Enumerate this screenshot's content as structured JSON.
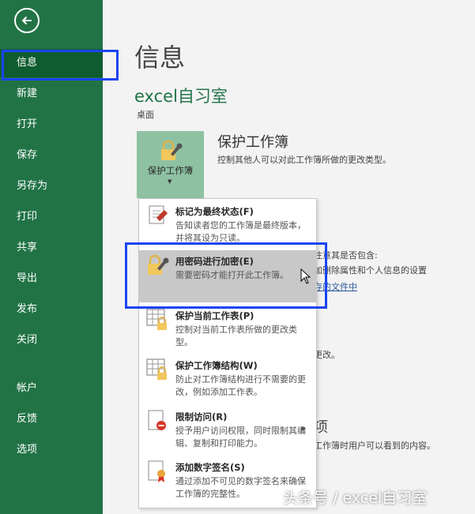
{
  "sidebar": {
    "items": [
      {
        "label": "信息"
      },
      {
        "label": "新建"
      },
      {
        "label": "打开"
      },
      {
        "label": "保存"
      },
      {
        "label": "另存为"
      },
      {
        "label": "打印"
      },
      {
        "label": "共享"
      },
      {
        "label": "导出"
      },
      {
        "label": "发布"
      },
      {
        "label": "关闭"
      },
      {
        "label": "帐户"
      },
      {
        "label": "反馈"
      },
      {
        "label": "选项"
      }
    ],
    "active": "信息"
  },
  "main": {
    "title": "信息",
    "workbook_name": "excel自习室",
    "location": "桌面",
    "protect": {
      "button_label": "保护工作簿",
      "heading": "保护工作簿",
      "description": "控制其他人可以对此工作簿所做的更改类型。"
    },
    "background_fragments": {
      "inspect_line": "注意其是否包含:",
      "inspect_detail": "加删除属性和个人信息的设置",
      "link": "存的文件中",
      "versions_tail": "更改。",
      "browser_letter": "项",
      "browser_desc": "工作簿时用户可以看到的内容。"
    }
  },
  "menu": {
    "items": [
      {
        "title": "标记为最终状态(F)",
        "desc": "告知读者您的工作簿是最终版本，并将其设为只读。"
      },
      {
        "title": "用密码进行加密(E)",
        "desc": "需要密码才能打开此工作簿。"
      },
      {
        "title": "保护当前工作表(P)",
        "desc": "控制对当前工作表所做的更改类型。"
      },
      {
        "title": "保护工作簿结构(W)",
        "desc": "防止对工作簿结构进行不需要的更改，例如添加工作表。"
      },
      {
        "title": "限制访问(R)",
        "desc": "授予用户访问权限，同时限制其编辑、复制和打印能力。"
      },
      {
        "title": "添加数字签名(S)",
        "desc": "通过添加不可见的数字签名来确保工作簿的完整性。"
      }
    ],
    "hovered": "用密码进行加密(E)"
  },
  "watermark": "头条号 / excel自习室",
  "colors": {
    "sidebar": "#217346",
    "accent": "#217346",
    "highlight": "#1a44f0",
    "tile": "#8ec1a2"
  }
}
